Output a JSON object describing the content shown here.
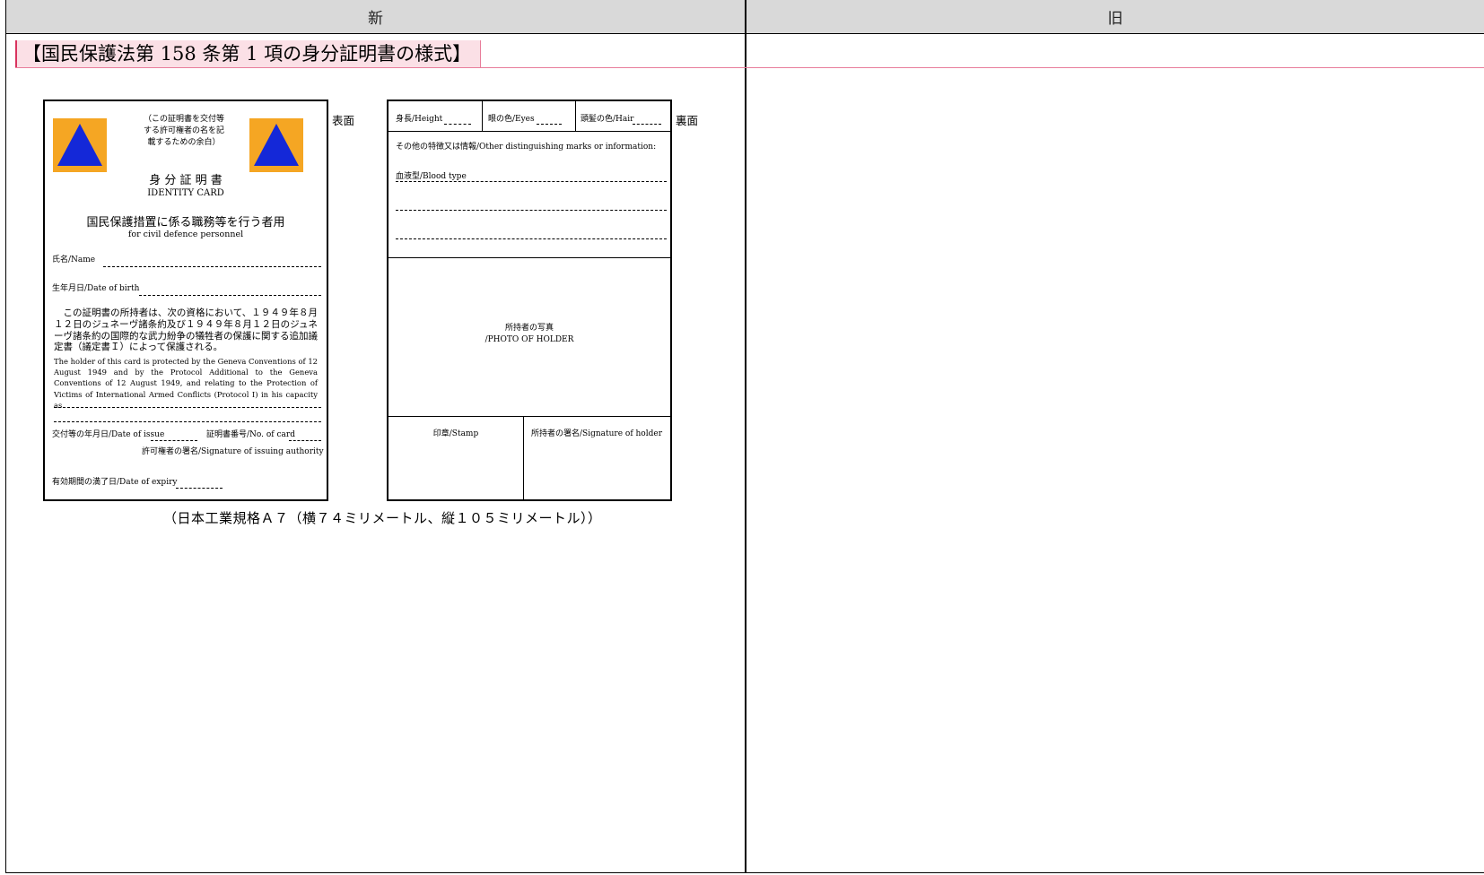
{
  "table": {
    "new_header": "新",
    "old_header": "旧"
  },
  "section_heading": "【国民保護法第 158 条第 1 項の身分証明書の様式】",
  "front": {
    "side_label": "表面",
    "blank_note": [
      "（この証明書を交付等",
      "する許可権者の名を記",
      "載するための余白）"
    ],
    "title_ja": "身 分 証 明 書",
    "title_en": "IDENTITY CARD",
    "subtitle_ja": "国民保護措置に係る職務等を行う者用",
    "subtitle_en": "for civil defence personnel",
    "name_label": "氏名/Name",
    "dob_label": "生年月日/Date of birth",
    "statement_ja": "この証明書の所持者は、次の資格において、１９４９年８月１２日のジュネーヴ諸条約及び１９４９年８月１２日のジュネーヴ諸条約の国際的な武力紛争の犠牲者の保護に関する追加議定書（議定書Ｉ）によって保護される。",
    "statement_en": "The holder of this card is protected by the Geneva Conventions of 12 August 1949 and by the Protocol Additional to the Geneva Conventions of 12 August 1949, and relating to the Protection of Victims of International Armed Conflicts (Protocol I) in his capacity as",
    "issue_date_label": "交付等の年月日/Date of issue",
    "card_no_label": "証明書番号/No. of card",
    "authority_sig_label": "許可権者の署名/Signature of issuing authority",
    "expiry_label": "有効期間の満了日/Date of expiry"
  },
  "back": {
    "side_label": "裏面",
    "height_label": "身長/Height",
    "eyes_label": "眼の色/Eyes",
    "hair_label": "頭髪の色/Hair",
    "other_marks_label": "その他の特徴又は情報/Other distinguishing marks or information:",
    "blood_type_label": "血液型/Blood type",
    "photo_label_ja": "所持者の写真",
    "photo_label_en": "/PHOTO OF HOLDER",
    "stamp_label": "印章/Stamp",
    "holder_sig_label": "所持者の署名/Signature of holder"
  },
  "caption": "（日本工業規格Ａ７（横７４ミリメートル、縦１０５ミリメートル））",
  "colors": {
    "emblem_orange": "#f5a623",
    "emblem_blue": "#1428d8",
    "header_gray": "#d9d9d9",
    "heading_highlight": "#fbe0e6",
    "heading_rule": "#e87d9a"
  }
}
